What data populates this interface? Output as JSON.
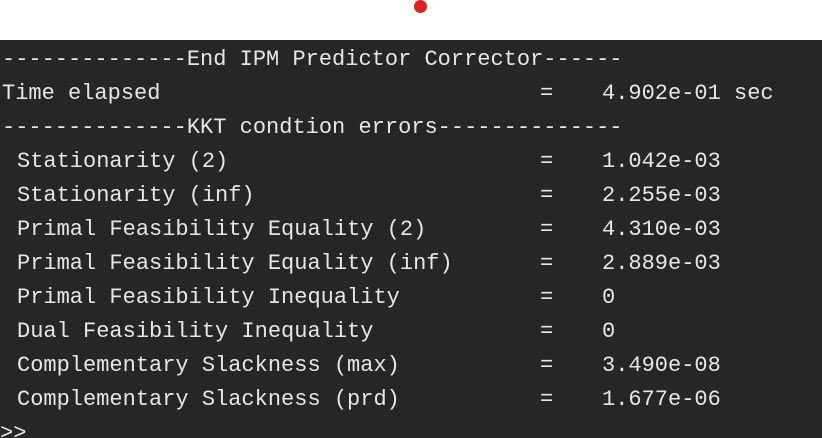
{
  "header": {
    "section_title": "--------------End IPM Predictor Corrector------",
    "kkt_title": "--------------KKT condtion errors--------------"
  },
  "time": {
    "label": "Time elapsed",
    "eq": "=",
    "value": "4.902e-01 sec"
  },
  "kkt_rows": [
    {
      "label": "Stationarity (2)",
      "eq": "=",
      "value": "1.042e-03"
    },
    {
      "label": "Stationarity (inf)",
      "eq": "=",
      "value": "2.255e-03"
    },
    {
      "label": "Primal Feasibility Equality (2)",
      "eq": "=",
      "value": "4.310e-03"
    },
    {
      "label": "Primal Feasibility Equality (inf)",
      "eq": "=",
      "value": "2.889e-03"
    },
    {
      "label": "Primal Feasibility Inequality",
      "eq": "=",
      "value": "0"
    },
    {
      "label": "Dual Feasibility Inequality",
      "eq": "=",
      "value": "0"
    },
    {
      "label": "Complementary Slackness (max)",
      "eq": "=",
      "value": "3.490e-08"
    },
    {
      "label": "Complementary Slackness (prd)",
      "eq": "=",
      "value": "1.677e-06"
    }
  ],
  "prompt": ">>",
  "colors": {
    "terminal_bg": "#262626",
    "terminal_text": "#e6e6e6",
    "record_dot": "#e02020"
  }
}
